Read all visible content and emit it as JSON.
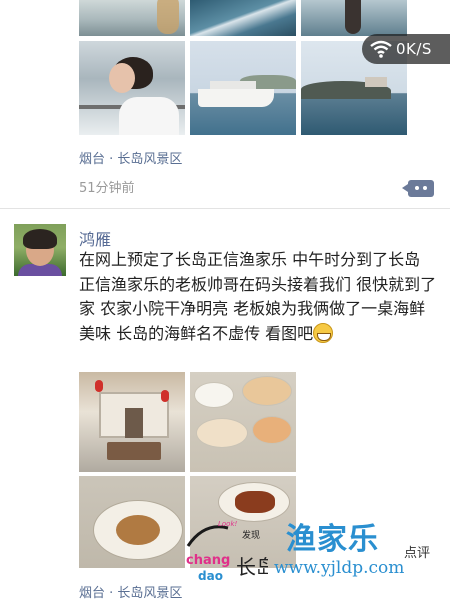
{
  "status_overlay": {
    "network_speed": "0K/S"
  },
  "posts": [
    {
      "location": "烟台 · 长岛风景区",
      "time": "51分钟前"
    },
    {
      "user_name": "鸿雁",
      "text": "在网上预定了长岛正信渔家乐  中午时分到了长岛   正信渔家乐的老板帅哥在码头接着我们  很快就到了家  农家小院干净明亮 老板娘为我俩做了一桌海鲜美味    长岛的海鲜名不虚传  看图吧",
      "location": "烟台 · 长岛风景区"
    }
  ],
  "watermark": {
    "logo_text_a": "Look!",
    "logo_text_b": "发现",
    "logo_text_c": "chang",
    "logo_text_d": "dao",
    "logo_text_e": "长岛",
    "title": "渔家乐",
    "subtitle": "点评",
    "url": "www.yjldp.com"
  },
  "colors": {
    "link_blue": "#576b95",
    "location_blue": "#5a6f93",
    "time_gray": "#9a9a9a",
    "watermark_blue": "#2a8fd0"
  }
}
